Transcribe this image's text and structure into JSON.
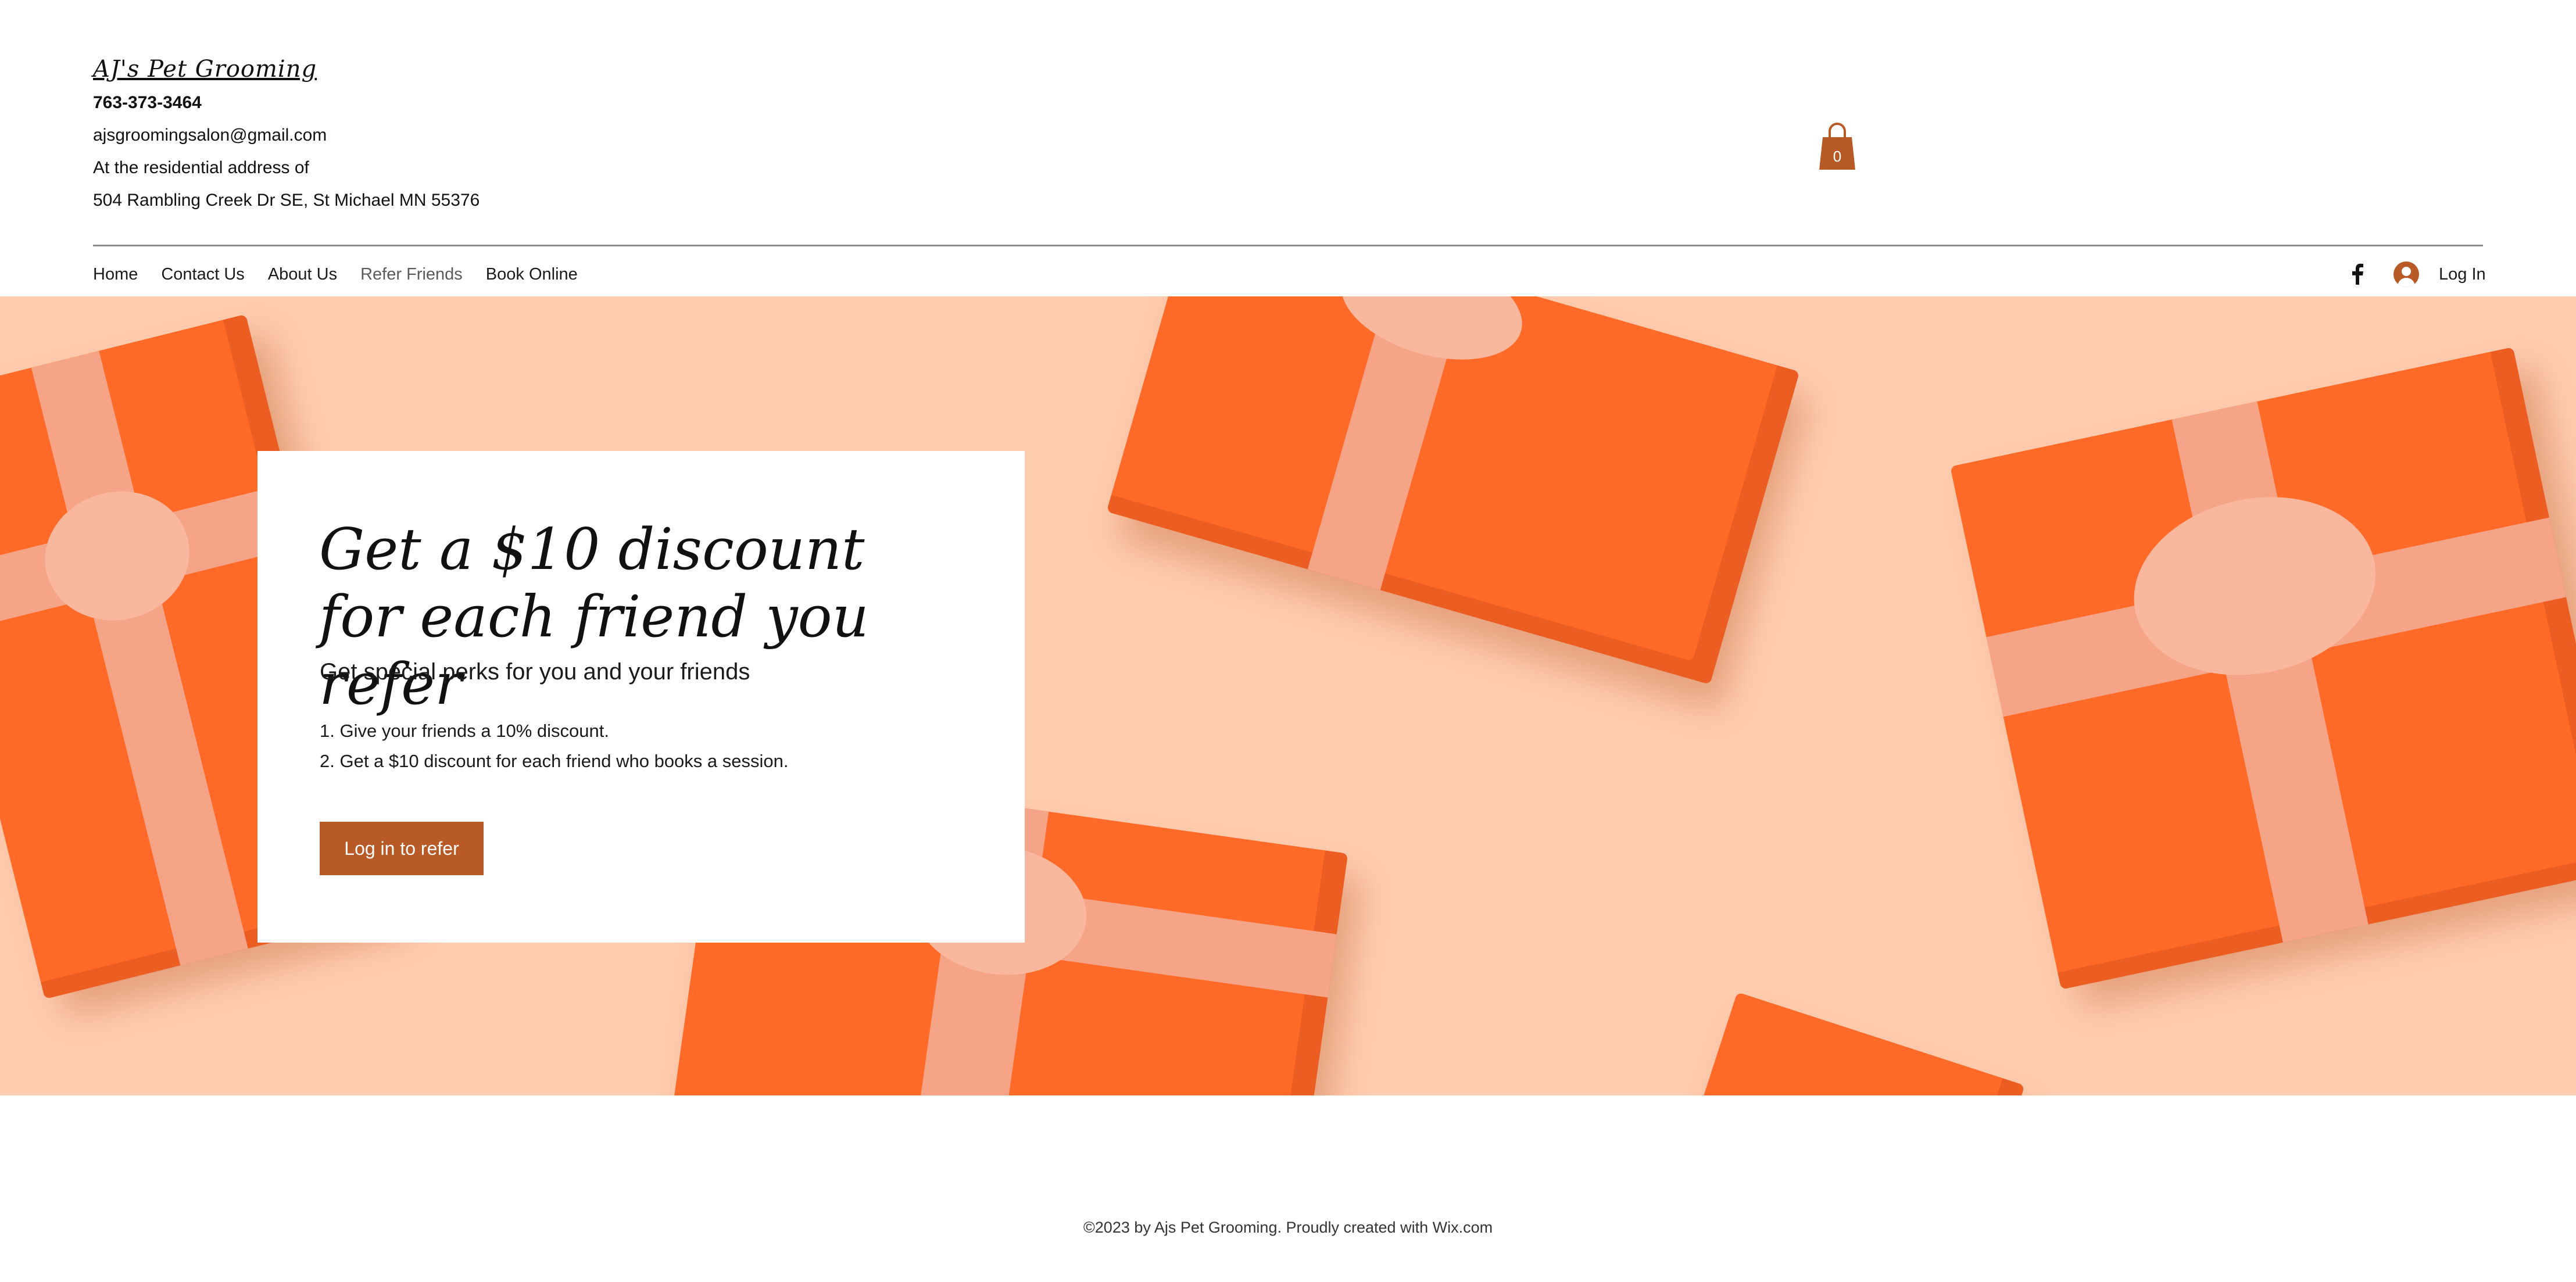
{
  "site": {
    "title": "AJ's Pet Grooming",
    "phone": "763-373-3464",
    "email": "ajsgroomingsalon@gmail.com",
    "address_line1": "At the residential address of",
    "address_line2": "504 Rambling Creek Dr SE, St Michael MN 55376"
  },
  "cart": {
    "count": "0",
    "icon": "shopping-bag-icon"
  },
  "nav": {
    "items": [
      {
        "label": "Home"
      },
      {
        "label": "Contact Us"
      },
      {
        "label": "About Us"
      },
      {
        "label": "Refer Friends",
        "active": true
      },
      {
        "label": "Book Online"
      }
    ],
    "social_icon": "facebook-icon",
    "login_label": "Log In"
  },
  "hero": {
    "headline": "Get a $10 discount for each friend you refer",
    "subhead": "Get special perks for you and your friends",
    "step1": "1. Give your friends a 10% discount.",
    "step2": "2. Get a $10 discount for each friend who books a session.",
    "cta_label": "Log in to refer"
  },
  "footer": {
    "text": "©2023 by Ajs Pet Grooming. Proudly created with Wix.com"
  },
  "colors": {
    "accent": "#b85a25",
    "hero_bg": "#ffccb0",
    "gift": "#ff6a28",
    "ribbon": "#f6a487"
  }
}
